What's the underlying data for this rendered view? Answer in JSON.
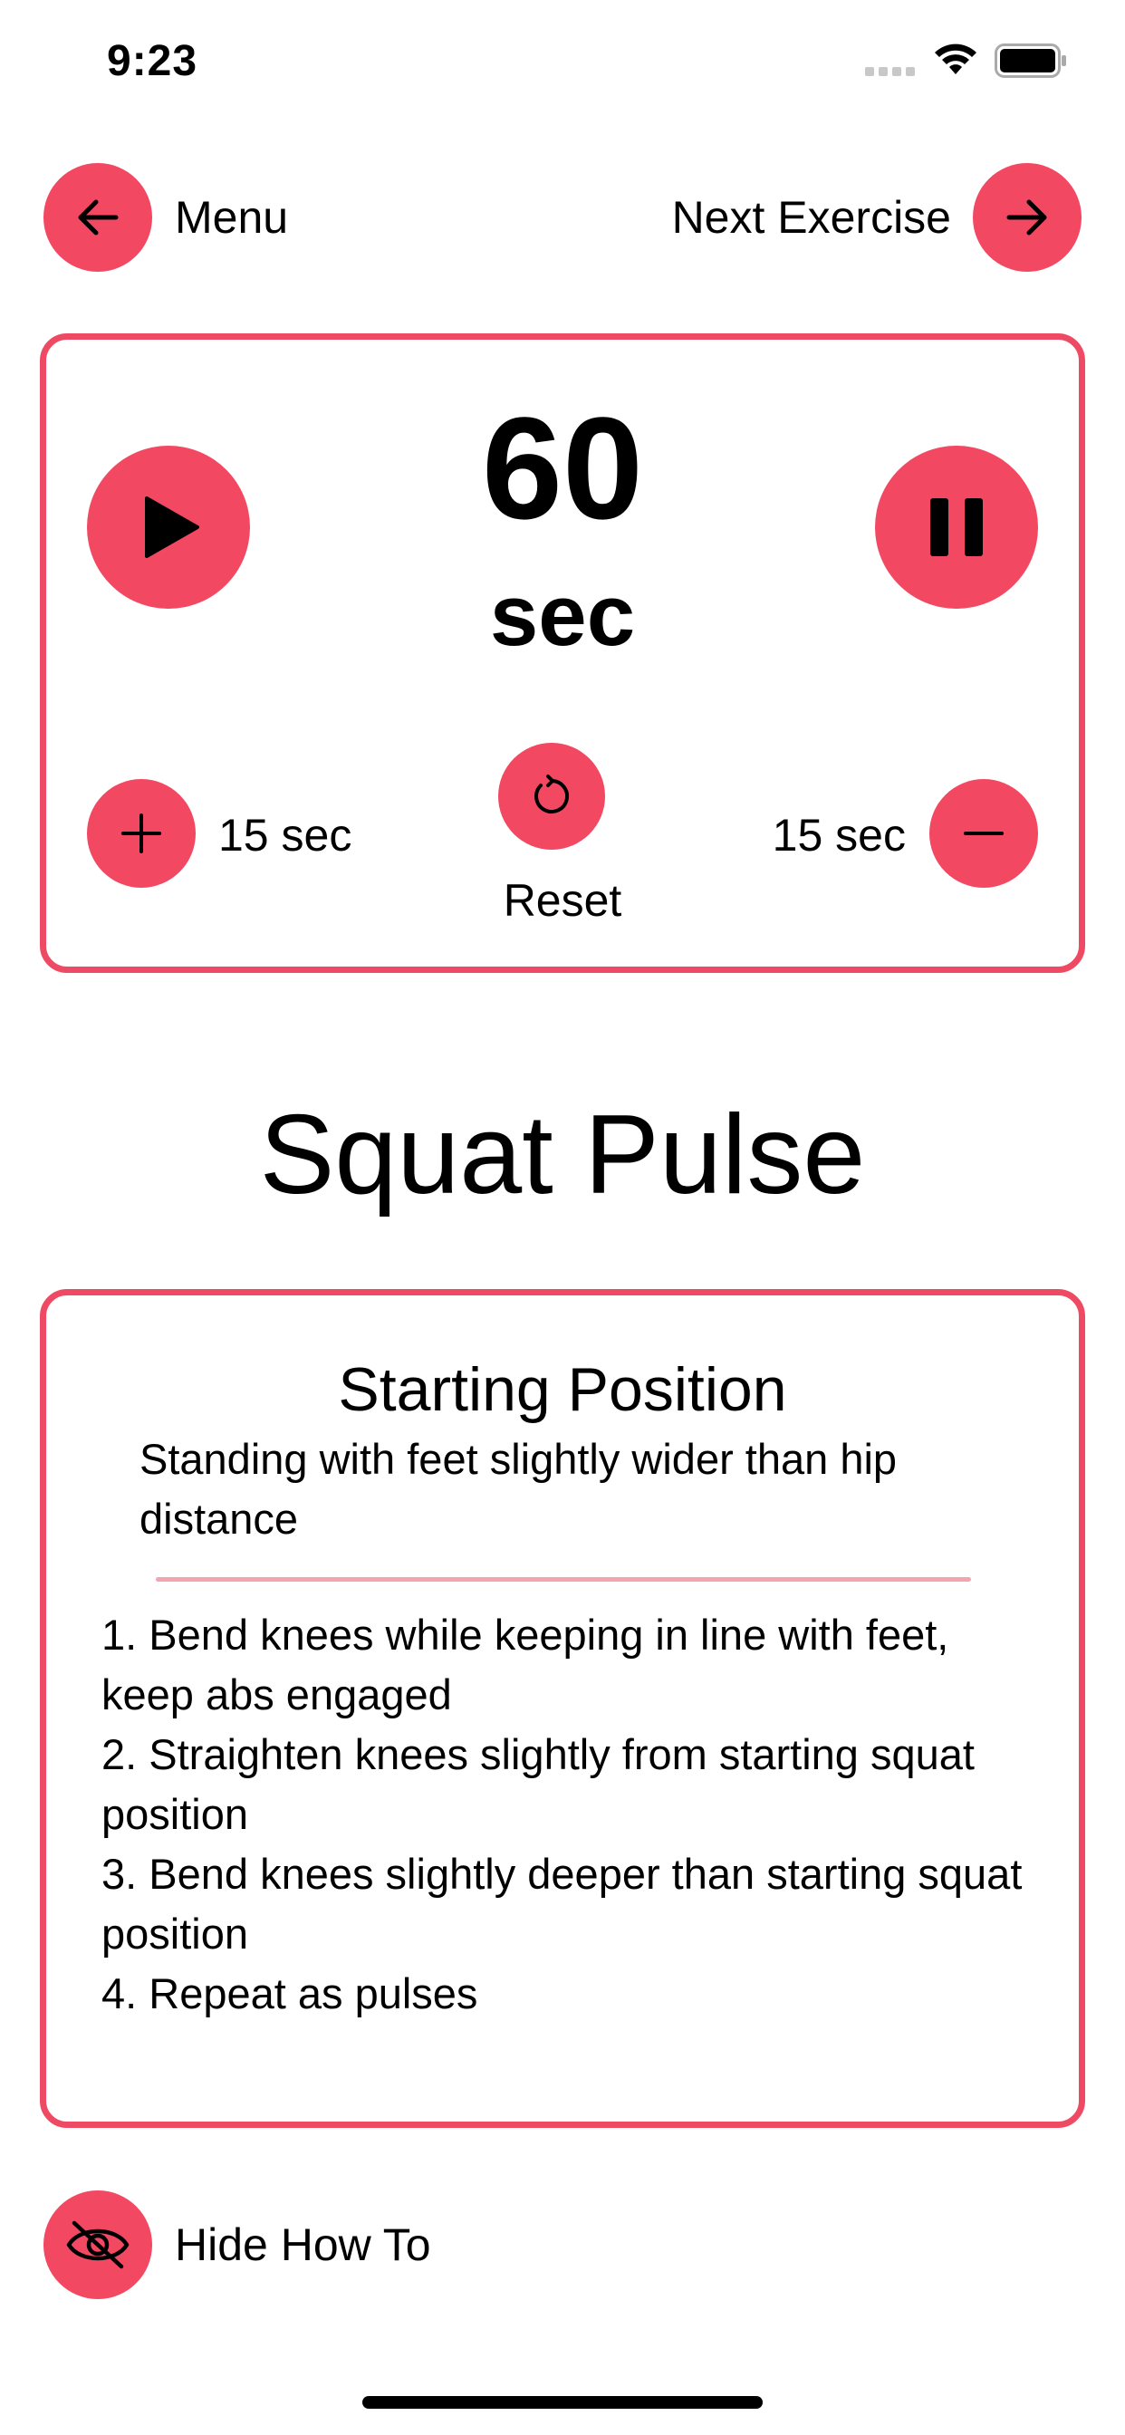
{
  "status_bar": {
    "time": "9:23"
  },
  "nav": {
    "back_label": "Menu",
    "next_label": "Next Exercise"
  },
  "timer": {
    "value": "60",
    "unit": "sec",
    "add_label": "15 sec",
    "subtract_label": "15 sec",
    "reset_label": "Reset"
  },
  "exercise": {
    "title": "Squat Pulse",
    "starting_position_heading": "Starting Position",
    "starting_position_text": "Standing with feet slightly wider than hip distance",
    "steps": [
      "1. Bend knees while keeping in line with feet, keep abs engaged",
      "2. Straighten knees slightly from starting squat position",
      "3. Bend knees slightly deeper than starting squat position",
      "4. Repeat as pulses"
    ]
  },
  "footer": {
    "toggle_label": "Hide How To"
  },
  "colors": {
    "accent": "#f24862",
    "border": "#ef4a64",
    "divider": "#f5a3ae"
  }
}
